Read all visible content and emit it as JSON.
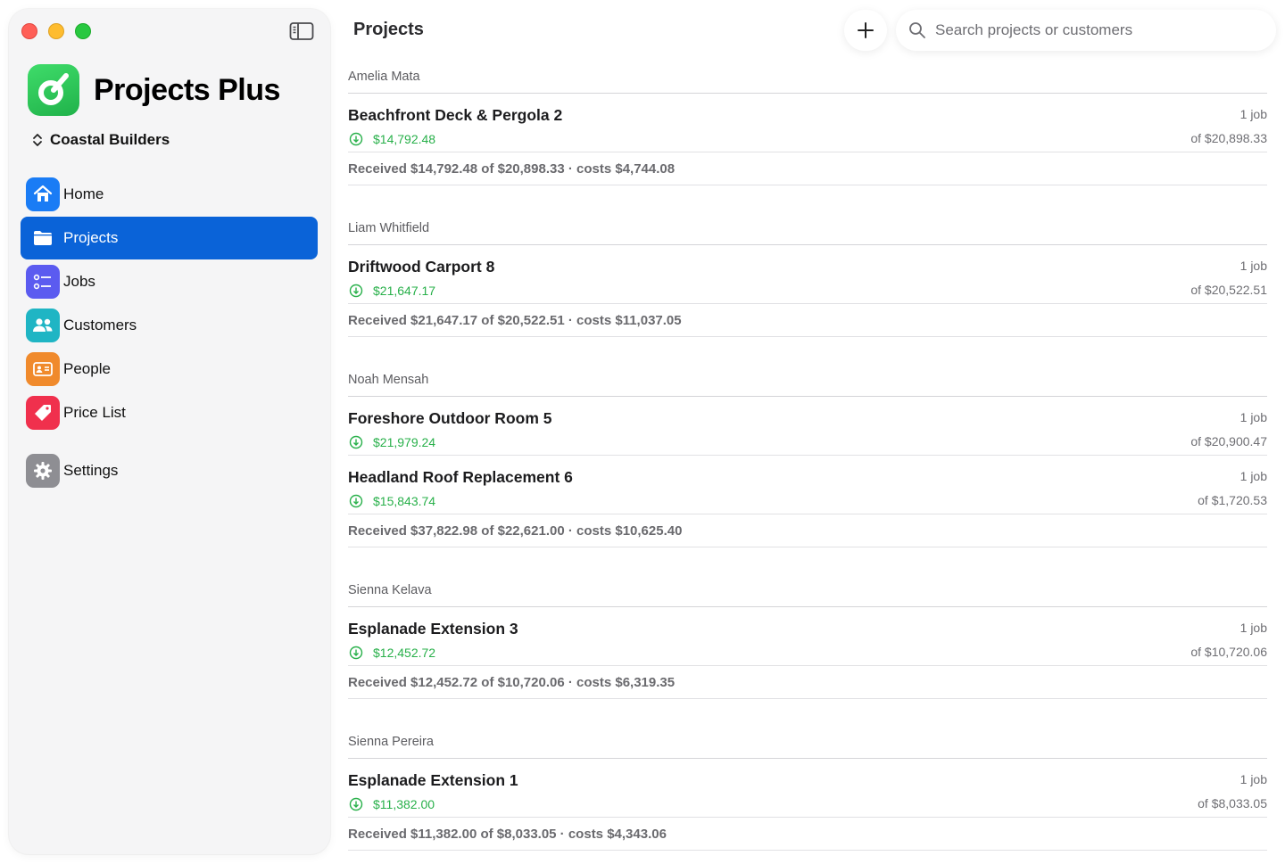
{
  "app": {
    "name": "Projects Plus",
    "organization": "Coastal Builders"
  },
  "sidebar": {
    "items": [
      {
        "label": "Home",
        "icon": "house-icon",
        "color": "#1a7cf5"
      },
      {
        "label": "Projects",
        "icon": "folder-icon",
        "color": "#0a63d8"
      },
      {
        "label": "Jobs",
        "icon": "checklist-icon",
        "color": "#5b5bf0"
      },
      {
        "label": "Customers",
        "icon": "people-icon",
        "color": "#1fb5c4"
      },
      {
        "label": "People",
        "icon": "id-card-icon",
        "color": "#f08a2c"
      },
      {
        "label": "Price List",
        "icon": "tag-icon",
        "color": "#f0304d"
      },
      {
        "label": "Settings",
        "icon": "gear-icon",
        "color": "#8e8e93"
      }
    ]
  },
  "header": {
    "title": "Projects",
    "search_placeholder": "Search projects or customers"
  },
  "groups": [
    {
      "customer": "Amelia Mata",
      "projects": [
        {
          "name": "Beachfront Deck & Pergola 2",
          "paid": "$14,792.48",
          "jobs": "1 job",
          "total": "of $20,898.33"
        }
      ],
      "summary": "Received $14,792.48 of $20,898.33 · costs $4,744.08"
    },
    {
      "customer": "Liam Whitfield",
      "projects": [
        {
          "name": "Driftwood Carport 8",
          "paid": "$21,647.17",
          "jobs": "1 job",
          "total": "of $20,522.51"
        }
      ],
      "summary": "Received $21,647.17 of $20,522.51 · costs $11,037.05"
    },
    {
      "customer": "Noah Mensah",
      "projects": [
        {
          "name": "Foreshore Outdoor Room 5",
          "paid": "$21,979.24",
          "jobs": "1 job",
          "total": "of $20,900.47"
        },
        {
          "name": "Headland Roof Replacement 6",
          "paid": "$15,843.74",
          "jobs": "1 job",
          "total": "of $1,720.53"
        }
      ],
      "summary": "Received $37,822.98 of $22,621.00 · costs $10,625.40"
    },
    {
      "customer": "Sienna Kelava",
      "projects": [
        {
          "name": "Esplanade Extension 3",
          "paid": "$12,452.72",
          "jobs": "1 job",
          "total": "of $10,720.06"
        }
      ],
      "summary": "Received $12,452.72 of $10,720.06 · costs $6,319.35"
    },
    {
      "customer": "Sienna Pereira",
      "projects": [
        {
          "name": "Esplanade Extension 1",
          "paid": "$11,382.00",
          "jobs": "1 job",
          "total": "of $8,033.05"
        }
      ],
      "summary": "Received $11,382.00 of $8,033.05 · costs $4,343.06"
    }
  ]
}
